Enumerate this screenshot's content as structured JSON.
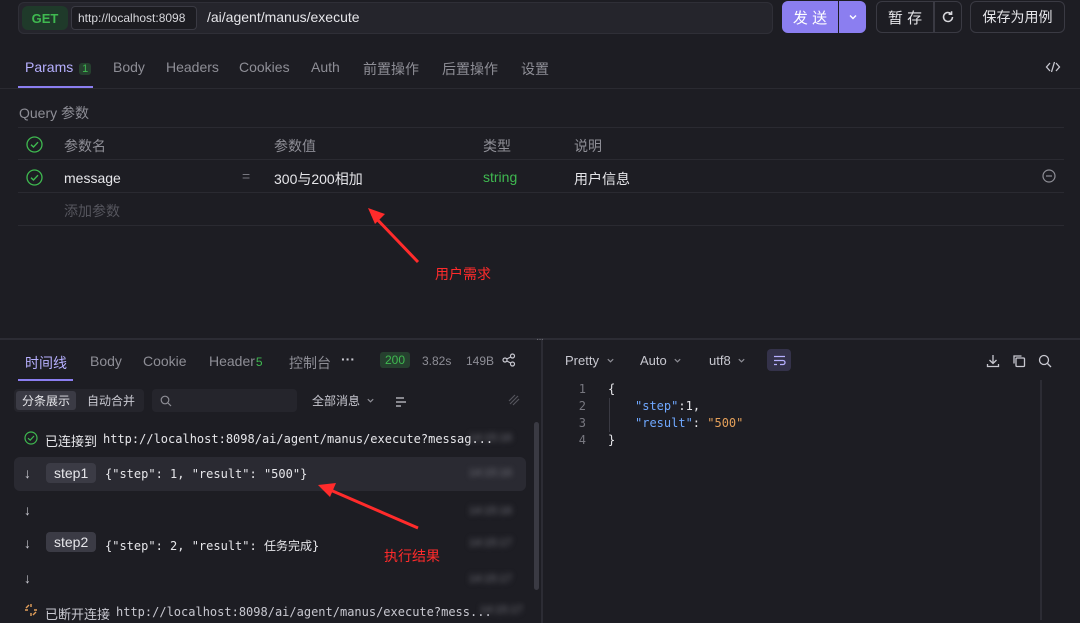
{
  "request": {
    "method": "GET",
    "base_url": "http://localhost:8098",
    "path": "/ai/agent/manus/execute",
    "send_label": "发 送",
    "save_label": "暂 存",
    "save_as_label": "保存为用例"
  },
  "req_tabs": [
    {
      "label": "Params",
      "badge": "1"
    },
    {
      "label": "Body"
    },
    {
      "label": "Headers"
    },
    {
      "label": "Cookies"
    },
    {
      "label": "Auth"
    },
    {
      "label": "前置操作"
    },
    {
      "label": "后置操作"
    },
    {
      "label": "设置"
    }
  ],
  "query": {
    "title": "Query 参数",
    "headers": [
      "参数名",
      "参数值",
      "类型",
      "说明"
    ],
    "row": {
      "name": "message",
      "eq": "=",
      "value": "300与200相加",
      "type": "string",
      "desc": "用户信息"
    },
    "add_placeholder": "添加参数"
  },
  "annotations": {
    "user_need": "用户需求",
    "exec_result": "执行结果"
  },
  "resp_tabs": [
    {
      "label": "时间线"
    },
    {
      "label": "Body"
    },
    {
      "label": "Cookie"
    },
    {
      "label": "Header",
      "badge": "5"
    },
    {
      "label": "控制台"
    },
    {
      "label": "···"
    }
  ],
  "status": {
    "code": "200",
    "time": "3.82s",
    "size": "149B"
  },
  "timeline_toolbar": {
    "split_label": "分条展示",
    "merge_label": "自动合并",
    "filter_label": "全部消息"
  },
  "timeline": [
    {
      "kind": "connected",
      "label": "已连接到",
      "text": "http://localhost:8098/ai/agent/manus/execute?messag..."
    },
    {
      "kind": "step",
      "tag": "step1",
      "text": "{\"step\": 1, \"result\": \"500\"}"
    },
    {
      "kind": "empty"
    },
    {
      "kind": "step",
      "tag": "step2",
      "text": "{\"step\": 2, \"result\": 任务完成}"
    },
    {
      "kind": "empty"
    },
    {
      "kind": "disconnected",
      "label": "已断开连接",
      "text": "http://localhost:8098/ai/agent/manus/execute?mess..."
    }
  ],
  "viewer": {
    "format": "Pretty",
    "encoding_mode": "Auto",
    "charset": "utf8",
    "lines": [
      {
        "n": "1",
        "text": "{"
      },
      {
        "n": "2",
        "key": "\"step\"",
        "val": " 1,",
        "valtype": "num"
      },
      {
        "n": "3",
        "key": "\"result\"",
        "val": " \"500\"",
        "valtype": "str"
      },
      {
        "n": "4",
        "text": "}"
      }
    ]
  },
  "colors": {
    "accent": "#8b7ef0",
    "annotation": "#ff2b2b",
    "success": "#3fb950",
    "string": "#e4a05a",
    "key": "#6fa8ff"
  }
}
